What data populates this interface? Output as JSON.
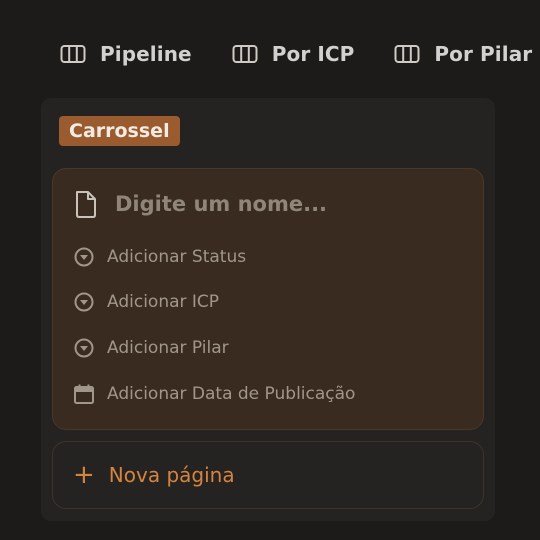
{
  "tabs": [
    {
      "label": "Pipeline",
      "icon": "board-icon"
    },
    {
      "label": "Por ICP",
      "icon": "board-icon"
    },
    {
      "label": "Por Pilar",
      "icon": "board-icon"
    }
  ],
  "group": {
    "label": "Carrossel",
    "color": "#9a5b2f"
  },
  "card": {
    "name_placeholder": "Digite um nome...",
    "properties": [
      {
        "label": "Adicionar Status",
        "icon": "select-icon"
      },
      {
        "label": "Adicionar ICP",
        "icon": "select-icon"
      },
      {
        "label": "Adicionar Pilar",
        "icon": "select-icon"
      },
      {
        "label": "Adicionar Data de Publicação",
        "icon": "calendar-icon"
      }
    ]
  },
  "new_page": {
    "label": "Nova página",
    "icon": "plus-icon"
  },
  "colors": {
    "accent": "#d4843f",
    "background": "#1c1b1a",
    "card": "#3a2b20"
  }
}
